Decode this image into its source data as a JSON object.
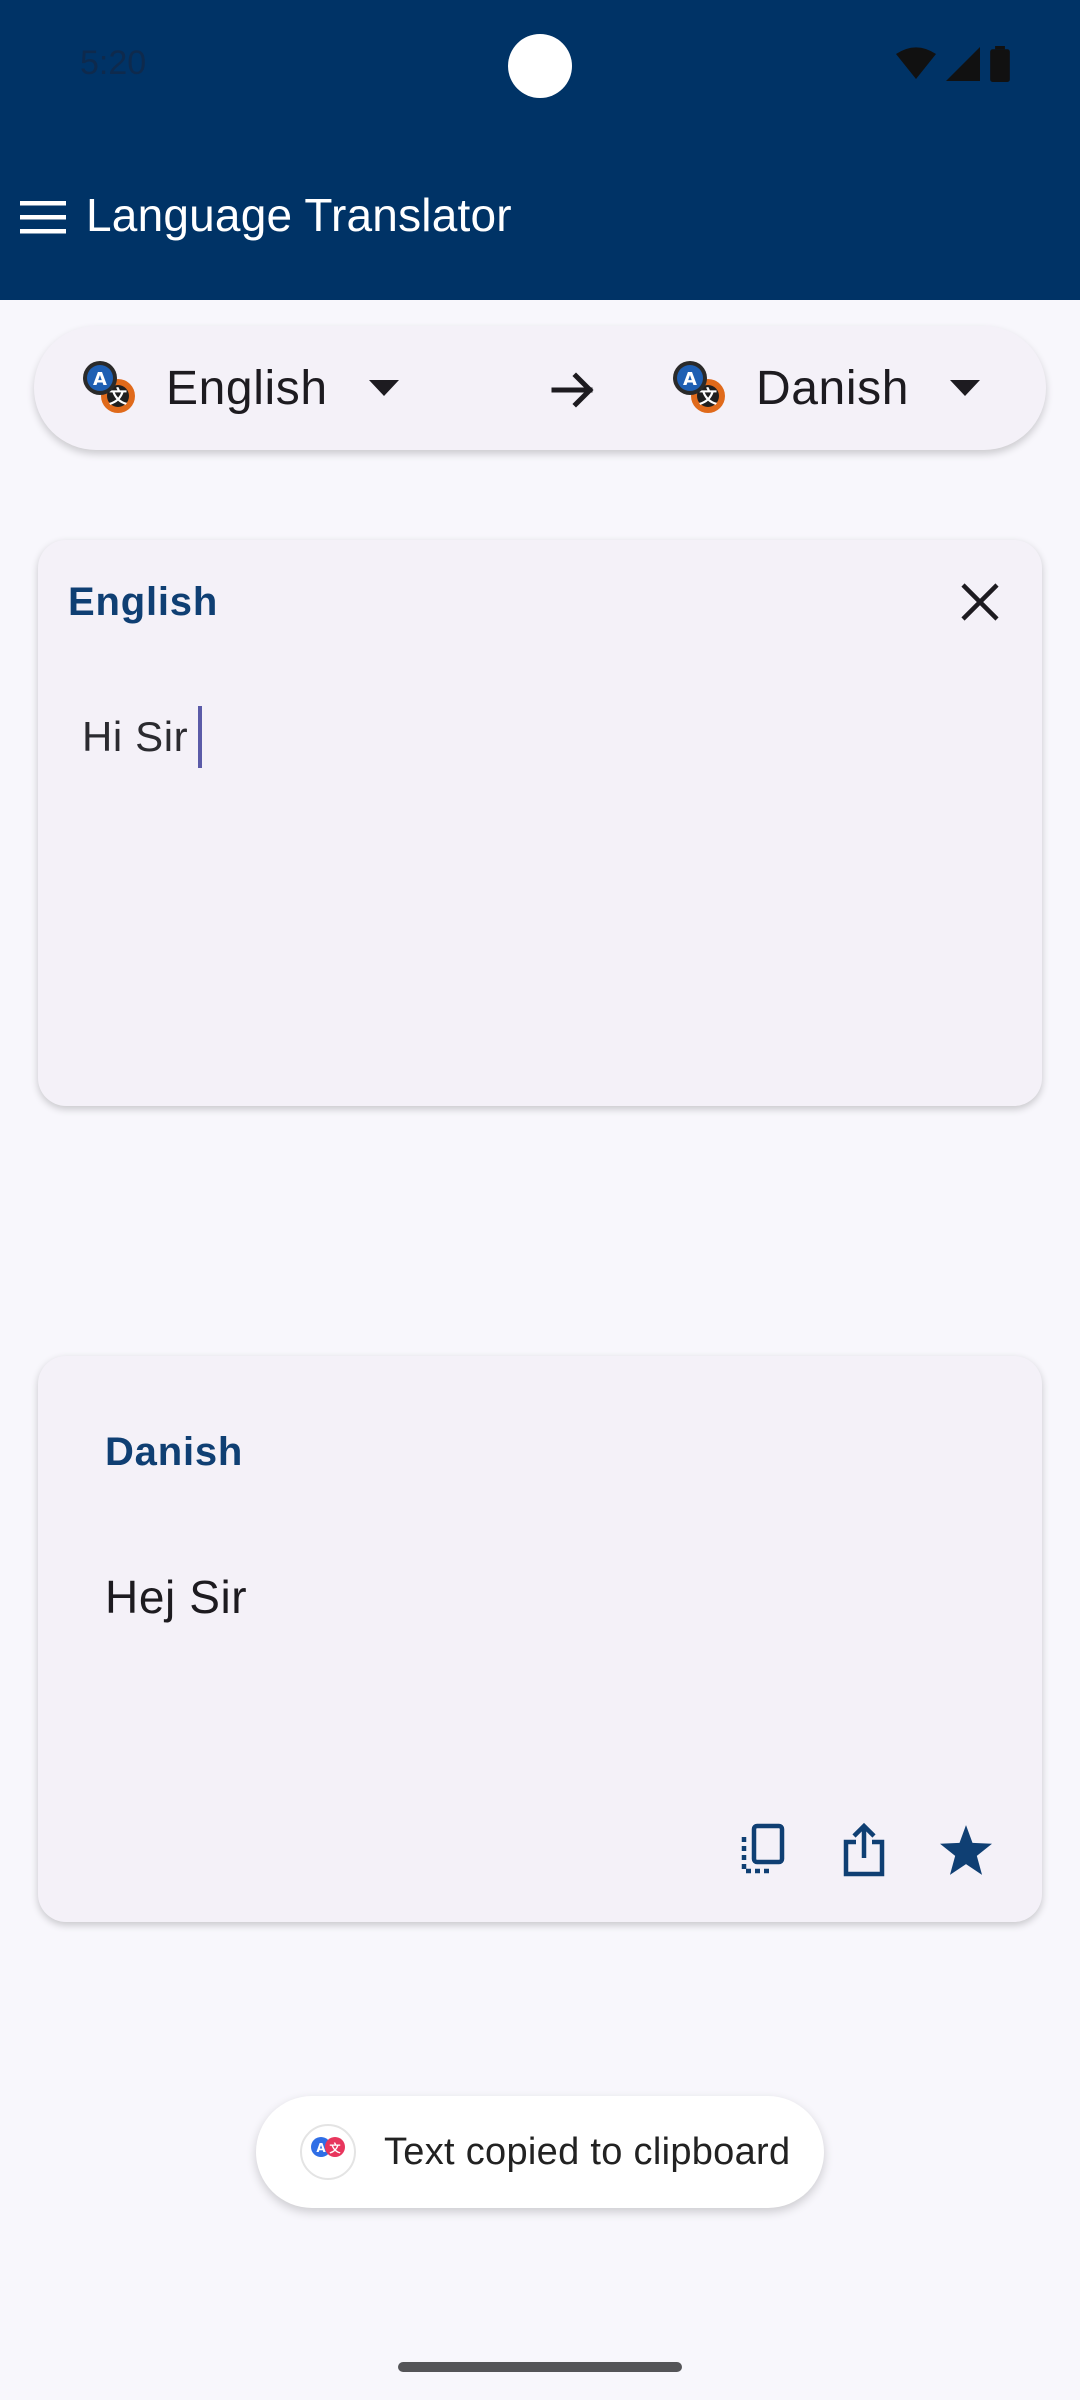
{
  "status_bar": {
    "time": "5:20"
  },
  "app_bar": {
    "title": "Language Translator",
    "menu_icon": "menu-icon"
  },
  "language_selector": {
    "source": "English",
    "target": "Danish",
    "swap_icon": "arrow-right-icon"
  },
  "input_card": {
    "label": "English",
    "text": "Hi Sir",
    "close_icon": "close-icon"
  },
  "output_card": {
    "label": "Danish",
    "text": "Hej Sir",
    "actions": [
      "copy-icon",
      "share-icon",
      "star-icon"
    ]
  },
  "toast": {
    "text": "Text copied to clipboard"
  },
  "colors": {
    "app_bar": "#003366",
    "accent": "#0f3f73",
    "card_bg": "#f4f1f8",
    "page_bg": "#f8f7fc"
  }
}
